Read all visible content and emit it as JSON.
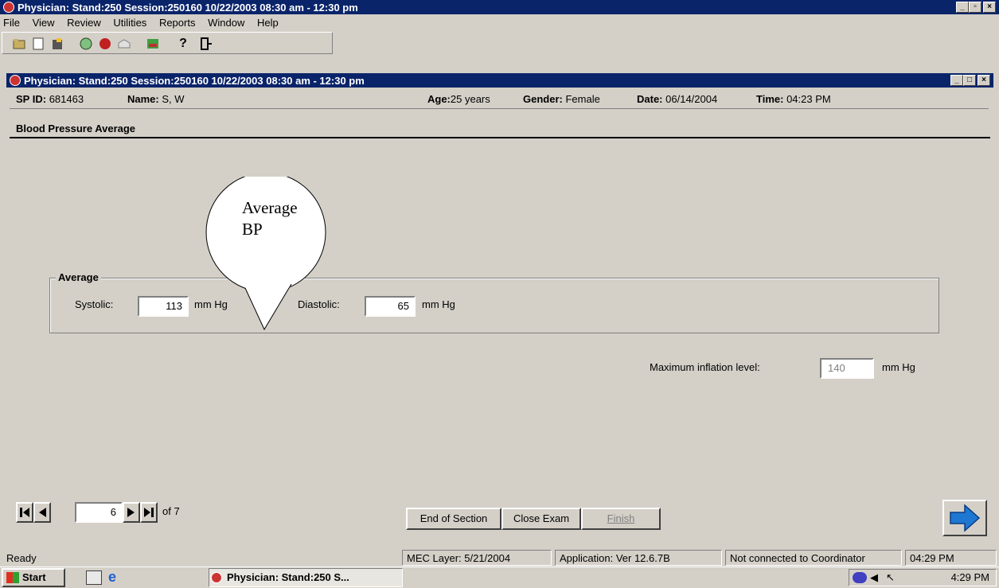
{
  "app_title": "Physician: Stand:250 Session:250160 10/22/2003 08:30 am - 12:30 pm",
  "menu": [
    "File",
    "View",
    "Review",
    "Utilities",
    "Reports",
    "Window",
    "Help"
  ],
  "child_title": "Physician: Stand:250 Session:250160 10/22/2003 08:30 am - 12:30 pm",
  "patient": {
    "sp_id_label": "SP ID:",
    "sp_id": "681463",
    "name_label": "Name:",
    "name": "S, W",
    "age_label": "Age:",
    "age": "25 years",
    "gender_label": "Gender:",
    "gender": "Female",
    "date_label": "Date:",
    "date": "06/14/2004",
    "time_label": "Time:",
    "time": "04:23 PM"
  },
  "section_title": "Blood Pressure Average",
  "callout_text": "Average BP",
  "average": {
    "group_label": "Average",
    "systolic_label": "Systolic:",
    "systolic_value": "113",
    "systolic_unit": "mm Hg",
    "diastolic_label": "Diastolic:",
    "diastolic_value": "65",
    "diastolic_unit": "mm Hg"
  },
  "max_inflation": {
    "label": "Maximum inflation level:",
    "value": "140",
    "unit": "mm Hg"
  },
  "nav": {
    "page": "6",
    "of_text": "of 7"
  },
  "buttons": {
    "end_section": "End of Section",
    "close_exam": "Close Exam",
    "finish": "Finish"
  },
  "status": {
    "ready": "Ready",
    "mec_layer": "MEC Layer: 5/21/2004",
    "application": "Application: Ver 12.6.7B",
    "coordinator": "Not connected to Coordinator",
    "time": "04:29 PM"
  },
  "taskbar": {
    "start": "Start",
    "task": "Physician: Stand:250 S...",
    "clock": "4:29 PM"
  },
  "colors": {
    "titlebar": "#0a246a",
    "desktop": "#d4d0c8",
    "arrow": "#1e78d2"
  }
}
